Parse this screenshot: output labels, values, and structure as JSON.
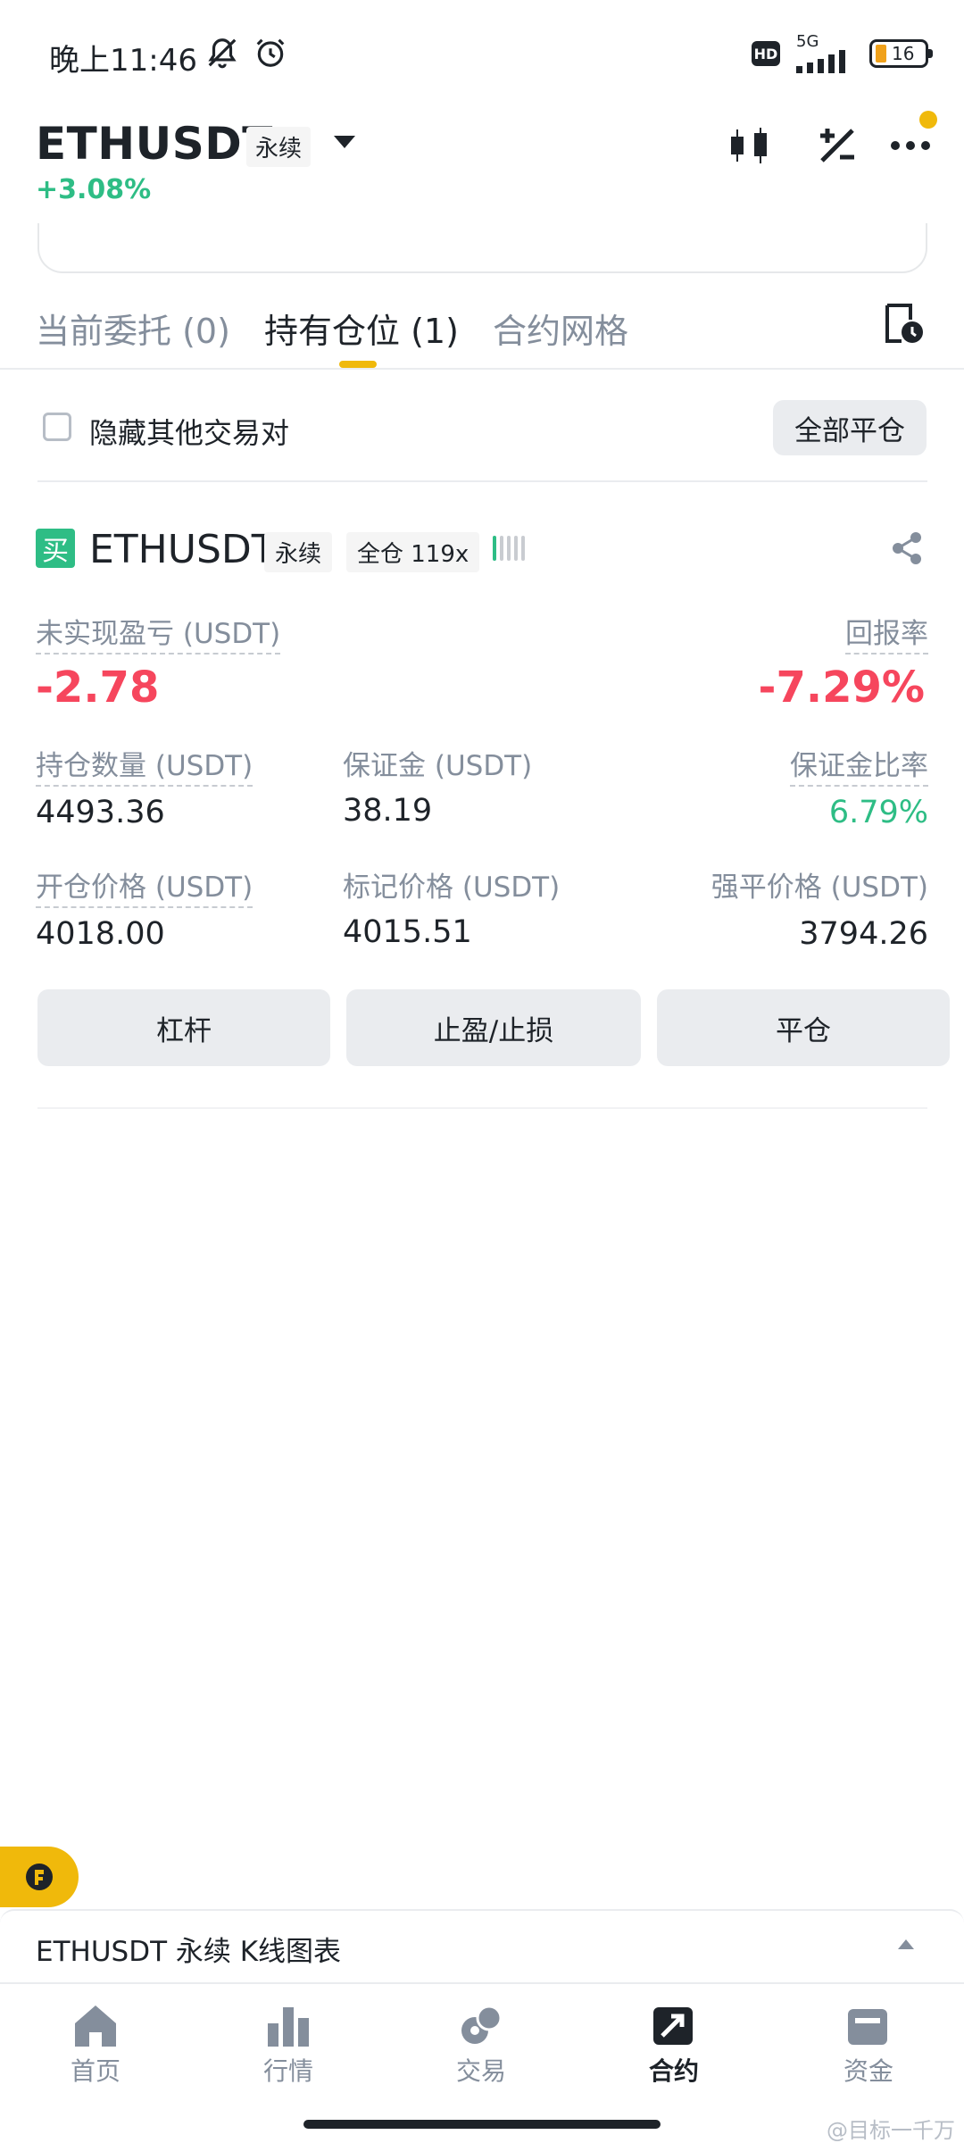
{
  "status_bar": {
    "time": "晚上11:46",
    "network": "5G",
    "hd": "HD",
    "battery": "16"
  },
  "header": {
    "symbol": "ETHUSDT",
    "contract_tag": "永续",
    "change_percent": "+3.08%"
  },
  "tabs": [
    {
      "label": "当前委托 (0)",
      "active": false
    },
    {
      "label": "持有仓位 (1)",
      "active": true
    },
    {
      "label": "合约网格",
      "active": false
    }
  ],
  "filter": {
    "hide_others_label": "隐藏其他交易对",
    "hide_others_checked": false,
    "close_all_label": "全部平仓"
  },
  "position": {
    "side_badge": "买",
    "symbol": "ETHUSDT",
    "contract_tag": "永续",
    "margin_tag": "全仓 119x",
    "adl_level": 1,
    "unrealized_pnl_label": "未实现盈亏 (USDT)",
    "unrealized_pnl": "-2.78",
    "roe_label": "回报率",
    "roe": "-7.29%",
    "size_label": "持仓数量 (USDT)",
    "size": "4493.36",
    "margin_label": "保证金 (USDT)",
    "margin": "38.19",
    "margin_ratio_label": "保证金比率",
    "margin_ratio": "6.79%",
    "entry_price_label": "开仓价格 (USDT)",
    "entry_price": "4018.00",
    "mark_price_label": "标记价格 (USDT)",
    "mark_price": "4015.51",
    "liq_price_label": "强平价格 (USDT)",
    "liq_price": "3794.26",
    "actions": [
      "杠杆",
      "止盈/止损",
      "平仓"
    ]
  },
  "kline_bar": {
    "label": "ETHUSDT 永续 K线图表"
  },
  "nav": [
    {
      "label": "首页",
      "icon": "home-icon",
      "active": false
    },
    {
      "label": "行情",
      "icon": "markets-icon",
      "active": false
    },
    {
      "label": "交易",
      "icon": "trade-icon",
      "active": false
    },
    {
      "label": "合约",
      "icon": "futures-icon",
      "active": true
    },
    {
      "label": "资金",
      "icon": "wallet-icon",
      "active": false
    }
  ],
  "watermark": "@目标一千万",
  "colors": {
    "up": "#2ebd85",
    "down": "#f6465d",
    "accent": "#f0b90b",
    "text": "#1e2329",
    "muted": "#848e9c"
  }
}
